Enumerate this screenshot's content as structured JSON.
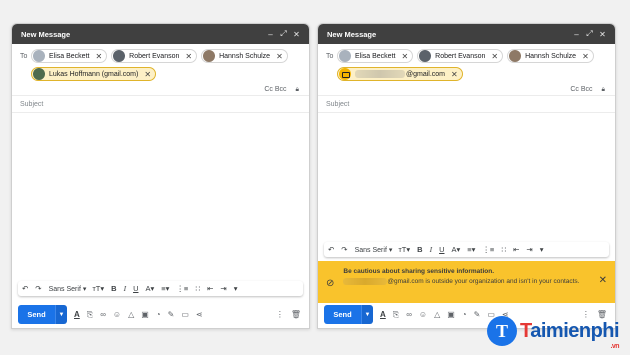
{
  "left": {
    "title": "New Message",
    "controls": [
      "–",
      "⤢",
      "✕"
    ],
    "to_label": "To",
    "recipients": [
      {
        "name": "Elisa Beckett",
        "avatar": "person-avatar"
      },
      {
        "name": "Robert Evanson",
        "avatar": "person-avatar"
      },
      {
        "name": "Hannsh Schulze",
        "avatar": "person-avatar"
      },
      {
        "name": "Lukas Hoffmann (gmail.com)",
        "avatar": "person-avatar"
      }
    ],
    "cc_bcc": "Cc Bcc",
    "subject_placeholder": "Subject",
    "send_label": "Send"
  },
  "right": {
    "title": "New Message",
    "controls": [
      "–",
      "⤢",
      "✕"
    ],
    "to_label": "To",
    "recipients": [
      {
        "name": "Elisa Beckett",
        "avatar": "person-avatar"
      },
      {
        "name": "Robert Evanson",
        "avatar": "person-avatar"
      },
      {
        "name": "Hannsh Schulze",
        "avatar": "person-avatar"
      }
    ],
    "external_recipient_suffix": "@gmail.com",
    "cc_bcc": "Cc Bcc",
    "subject_placeholder": "Subject",
    "send_label": "Send",
    "warning": {
      "title": "Be cautious about sharing sensitive information.",
      "body_suffix": "@gmail.com is outside your organization and isn't in your contacts."
    }
  },
  "format_toolbar": {
    "font": "Sans Serif",
    "icons": [
      "undo-icon",
      "redo-icon",
      "font-size-icon",
      "bold-icon",
      "italic-icon",
      "underline-icon",
      "text-color-icon",
      "align-icon",
      "numbered-list-icon",
      "bulleted-list-icon",
      "indent-less-icon",
      "indent-more-icon",
      "more-formatting-icon"
    ]
  },
  "watermark": {
    "brand_a": "T",
    "brand_b": "aimienphi",
    "tld": ".vn"
  },
  "colors": {
    "titlebar": "#404040",
    "send": "#1a73e8",
    "warning": "#f9c32c",
    "external_chip": "#fdf0c6"
  }
}
